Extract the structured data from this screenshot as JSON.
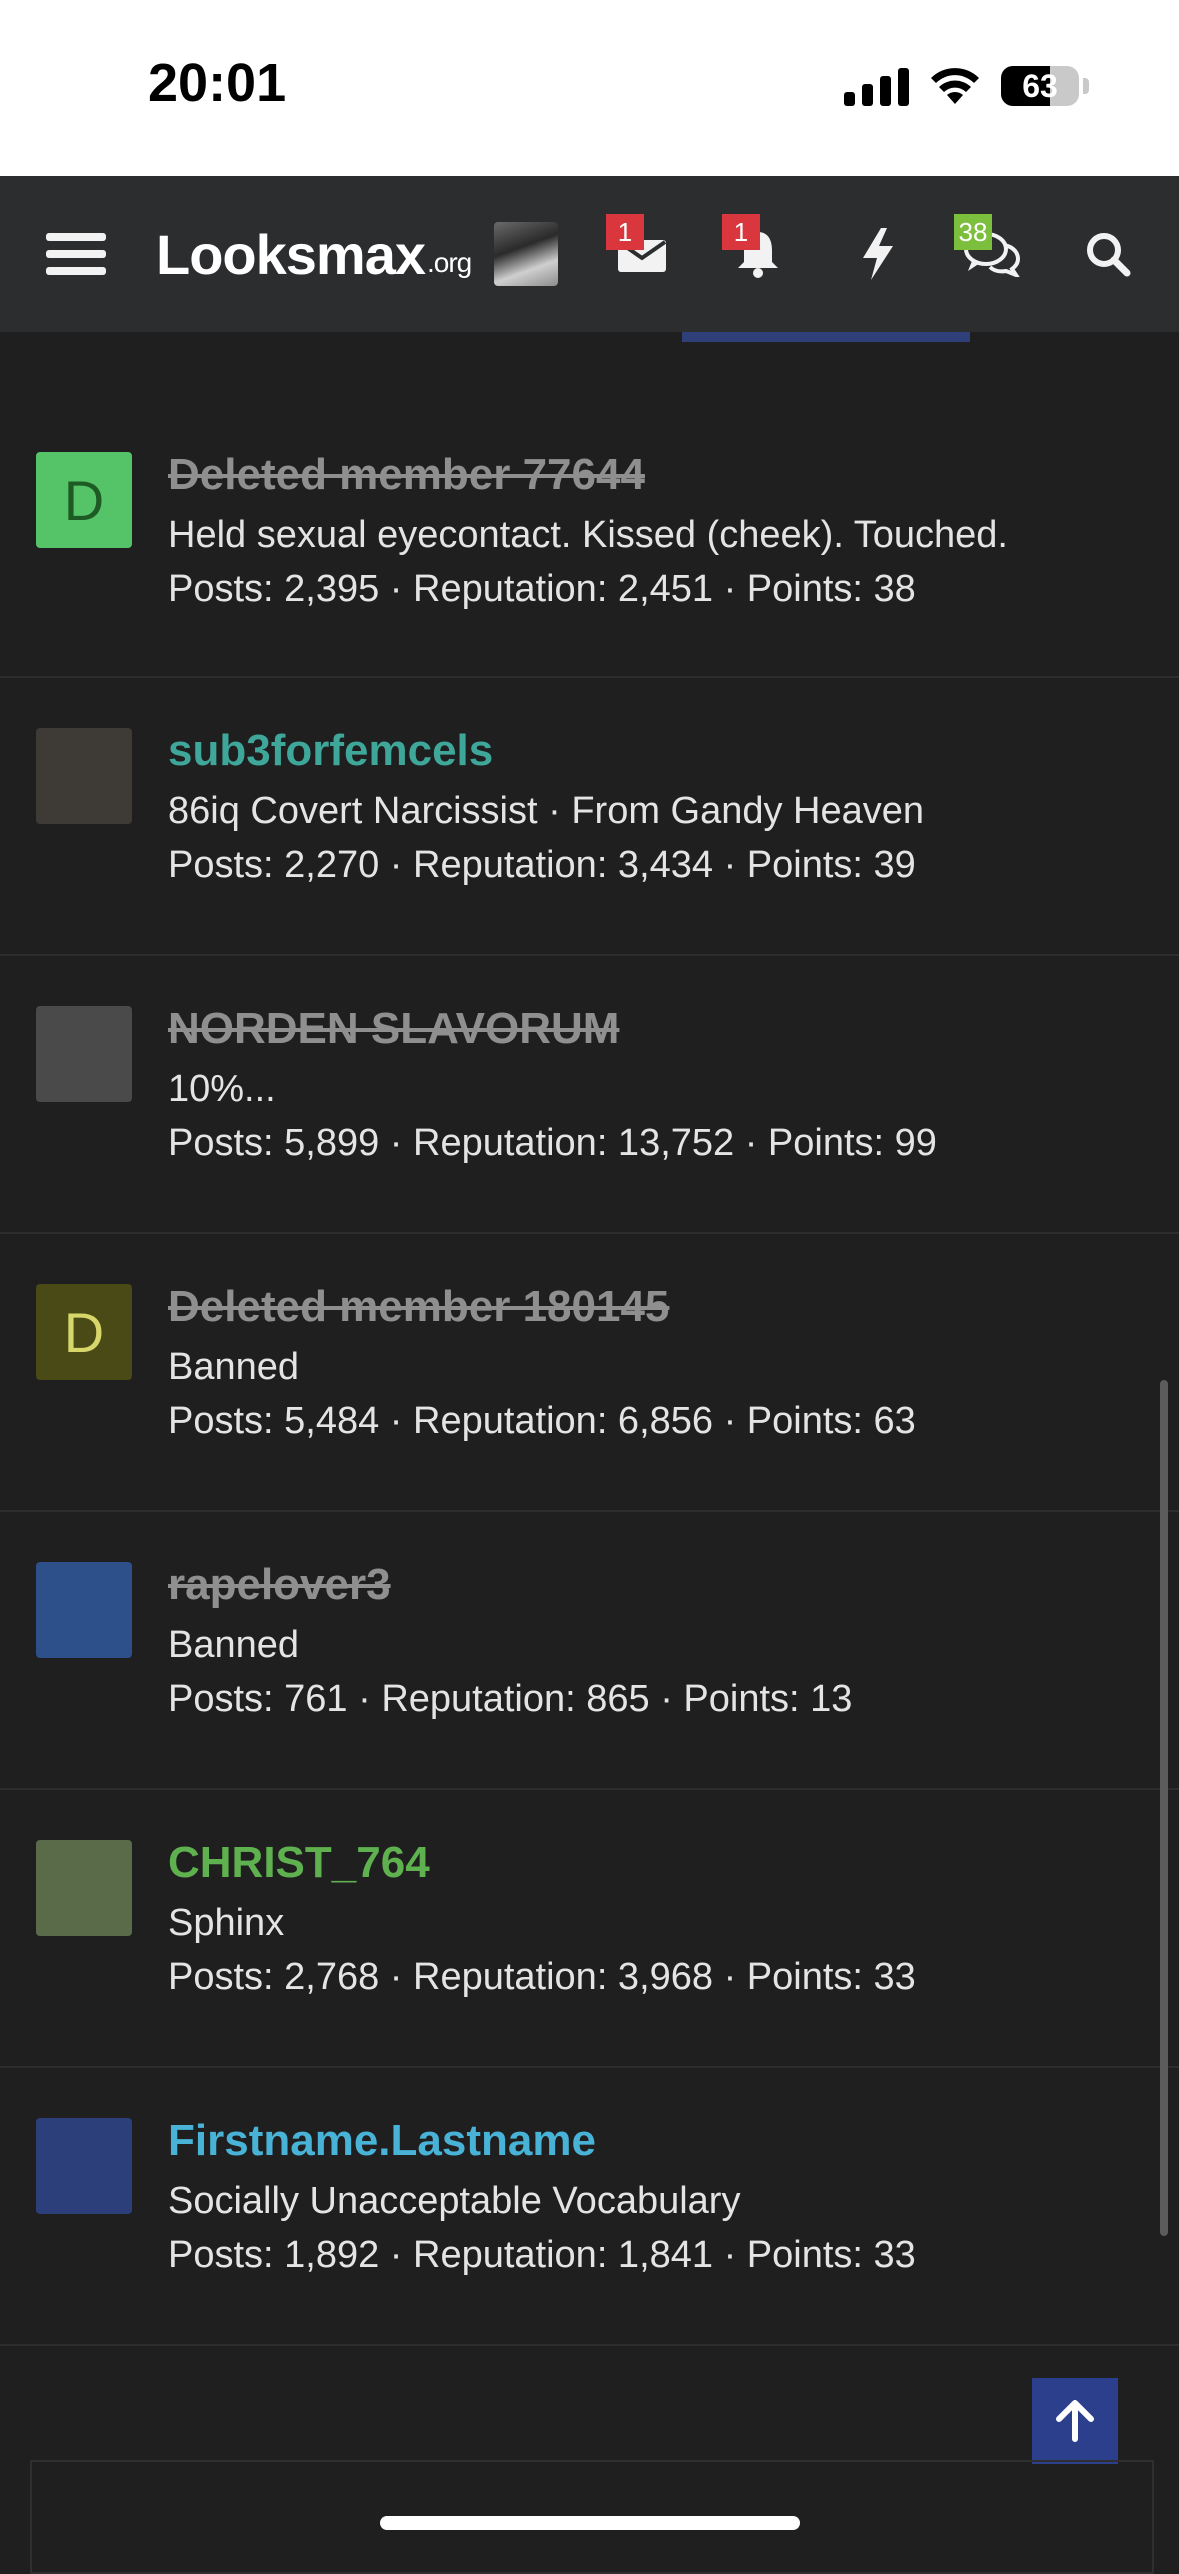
{
  "status_bar": {
    "time": "20:01",
    "battery": "63"
  },
  "nav": {
    "logo_main": "Looksmax",
    "logo_suffix": ".org",
    "inbox_badge": "1",
    "alerts_badge": "1",
    "conversations_badge": "38"
  },
  "members": [
    {
      "avatar_letter": "D",
      "avatar_color": "#55c468",
      "avatar_letter_color": "#1d5a24",
      "name": "Deleted member 77644",
      "name_style": "deleted",
      "title": "Held sexual eyecontact. Kissed (cheek). Touched.",
      "stats": "Posts: 2,395 · Reputation: 2,451 · Points: 38"
    },
    {
      "avatar_letter": "",
      "avatar_color": "#3e3a35",
      "name": "sub3forfemcels",
      "name_color": "#3fa79a",
      "title": "86iq Covert Narcissist · From Gandy Heaven",
      "stats": "Posts: 2,270 · Reputation: 3,434 · Points: 39"
    },
    {
      "avatar_letter": "",
      "avatar_color": "#4a4a4a",
      "name": "NORDEN SLAVORUM",
      "name_style": "deleted",
      "title": "10%...",
      "stats": "Posts: 5,899 · Reputation: 13,752 · Points: 99"
    },
    {
      "avatar_letter": "D",
      "avatar_color": "#4a4a16",
      "avatar_letter_color": "#d6d66a",
      "name": "Deleted member 180145",
      "name_style": "deleted",
      "title": "Banned",
      "stats": "Posts: 5,484 · Reputation: 6,856 · Points: 63"
    },
    {
      "avatar_letter": "",
      "avatar_color": "#2d4f8a",
      "name": "rapelover3",
      "name_style": "deleted",
      "title": "Banned",
      "stats": "Posts: 761 · Reputation: 865 · Points: 13"
    },
    {
      "avatar_letter": "",
      "avatar_color": "#5a6b4a",
      "name": "CHRIST_764",
      "name_color": "#5fb14f",
      "title": "Sphinx",
      "stats": "Posts: 2,768 · Reputation: 3,968 · Points: 33"
    },
    {
      "avatar_letter": "",
      "avatar_color": "#2c3f7a",
      "name": "Firstname.Lastname",
      "name_color": "#48b3d6",
      "title": "Socially Unacceptable Vocabulary",
      "stats": "Posts: 1,892 · Reputation: 1,841 · Points: 33"
    }
  ]
}
